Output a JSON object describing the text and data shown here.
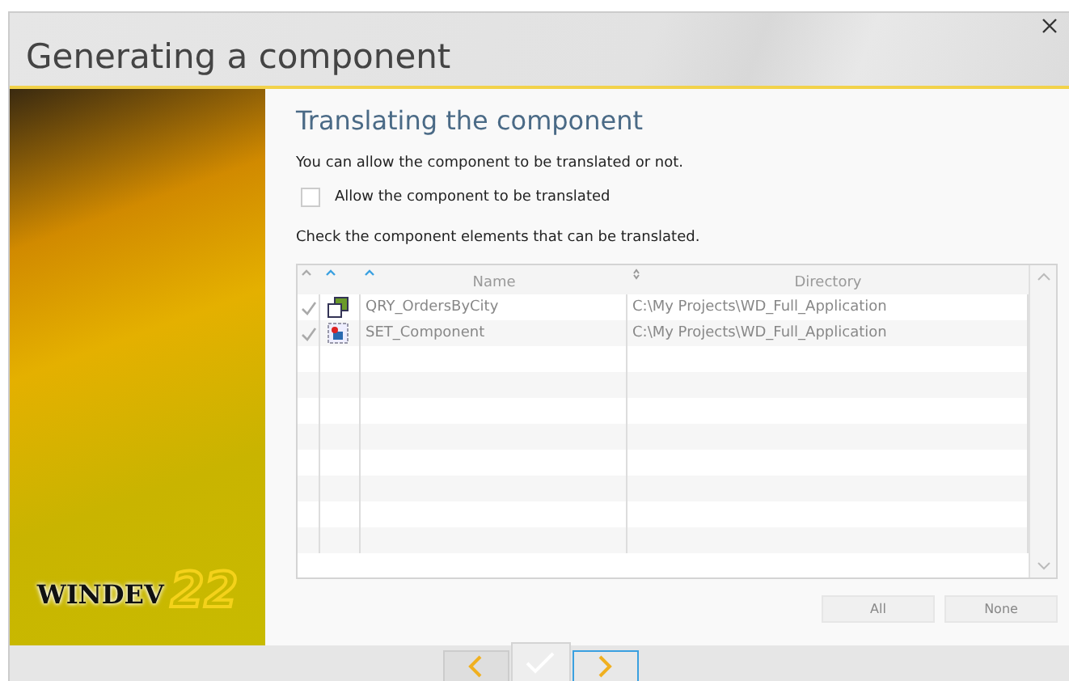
{
  "window": {
    "title": "Generating a component"
  },
  "sidebar": {
    "logo_text": "WINDEV",
    "logo_version": "22"
  },
  "page": {
    "heading": "Translating the component",
    "intro": "You can allow the component to be translated or not.",
    "allow_checkbox": {
      "label": "Allow the component to be translated",
      "checked": false
    },
    "table_hint": "Check the component elements that can be translated."
  },
  "table": {
    "columns": [
      {
        "label": "Name"
      },
      {
        "label": "Directory"
      }
    ],
    "rows": [
      {
        "kind": "query",
        "checked": true,
        "name": "QRY_OrdersByCity",
        "directory": "C:\\My Projects\\WD_Full_Application"
      },
      {
        "kind": "set",
        "checked": true,
        "name": "SET_Component",
        "directory": "C:\\My Projects\\WD_Full_Application"
      }
    ]
  },
  "buttons": [
    {
      "label": "All"
    },
    {
      "label": "None"
    }
  ]
}
